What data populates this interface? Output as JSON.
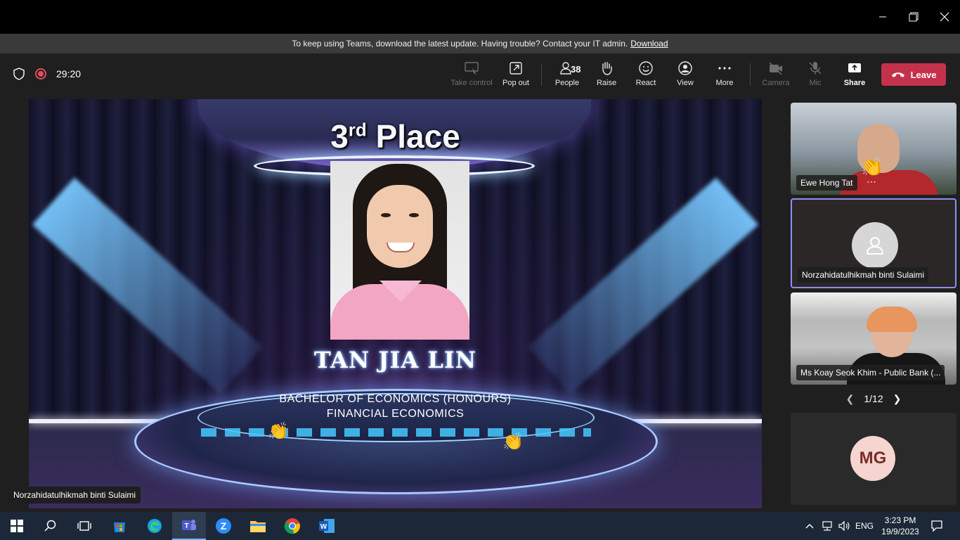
{
  "window": {
    "minimize_icon": "minimize-icon",
    "maximize_icon": "maximize-icon",
    "close_icon": "close-icon"
  },
  "banner": {
    "text": "To keep using Teams, download the latest update. Having trouble? Contact your IT admin.",
    "link": "Download"
  },
  "meeting": {
    "timer": "29:20",
    "recording": true
  },
  "toolbar": {
    "take_control": "Take control",
    "pop_out": "Pop out",
    "people": "People",
    "people_count": "38",
    "raise": "Raise",
    "react": "React",
    "view": "View",
    "more": "More",
    "camera": "Camera",
    "mic": "Mic",
    "share": "Share",
    "leave": "Leave"
  },
  "stage": {
    "place_number": "3",
    "place_suffix": "rd",
    "place_word": " Place",
    "student_name": "TAN JIA LIN",
    "degree_line1": "BACHELOR OF ECONOMICS (HONOURS)",
    "degree_line2": "FINANCIAL ECONOMICS",
    "presenter": "Norzahidatulhikmah binti Sulaimi",
    "reaction_emoji": "👏"
  },
  "gallery": {
    "tiles": [
      {
        "name": "Ewe Hong Tat",
        "reaction": "👏"
      },
      {
        "name": "Norzahidatulhikmah binti Sulaimi"
      },
      {
        "name": "Ms Koay Seok Khim - Public Bank (..."
      },
      {
        "initials": "MG"
      }
    ],
    "page": "1/12"
  },
  "taskbar": {
    "language": "ENG",
    "time": "3:23 PM",
    "date": "19/9/2023"
  },
  "colors": {
    "leave": "#c4314b",
    "recording": "#e34c5c",
    "active_tile_border": "#8f8ff8",
    "taskbar": "#1c2838"
  }
}
